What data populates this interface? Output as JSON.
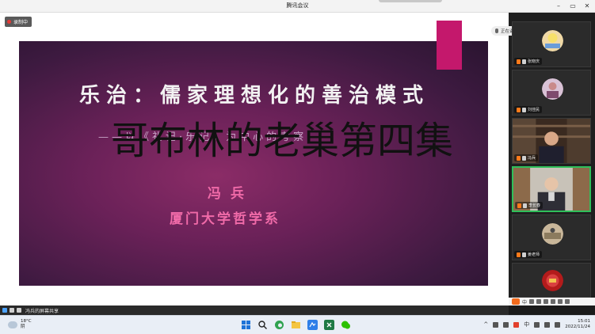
{
  "window": {
    "title": "腾讯会议"
  },
  "record": {
    "label": "录制中"
  },
  "speaking": {
    "label": "正在讲话：李长春"
  },
  "slide": {
    "title": "乐治：儒家理想化的善治模式",
    "subtitle": "——以《礼记·乐记》为中心的考察",
    "author": "冯兵",
    "affiliation": "厦门大学哲学系"
  },
  "overlay": {
    "text": "哥布林的老巢第四集"
  },
  "participants": [
    {
      "name": "张晓庆",
      "kind": "avatar",
      "active": false
    },
    {
      "name": "刘佳民",
      "kind": "avatar",
      "active": false
    },
    {
      "name": "冯兵",
      "kind": "video",
      "active": false
    },
    {
      "name": "李长春",
      "kind": "video",
      "active": true
    },
    {
      "name": "姜老师",
      "kind": "avatar",
      "active": false
    },
    {
      "name": "",
      "kind": "avatar",
      "active": false
    }
  ],
  "status": {
    "share_label": "冯兵的屏幕共享"
  },
  "ime": {
    "lang": "中"
  },
  "taskbar": {
    "weather_temp": "18°C",
    "weather_desc": "阴",
    "time": "15:01",
    "date": "2022/11/24"
  },
  "colors": {
    "accent": "#2fbf5a",
    "slide_text": "#f06aa8",
    "ribbon": "#c4186c"
  }
}
